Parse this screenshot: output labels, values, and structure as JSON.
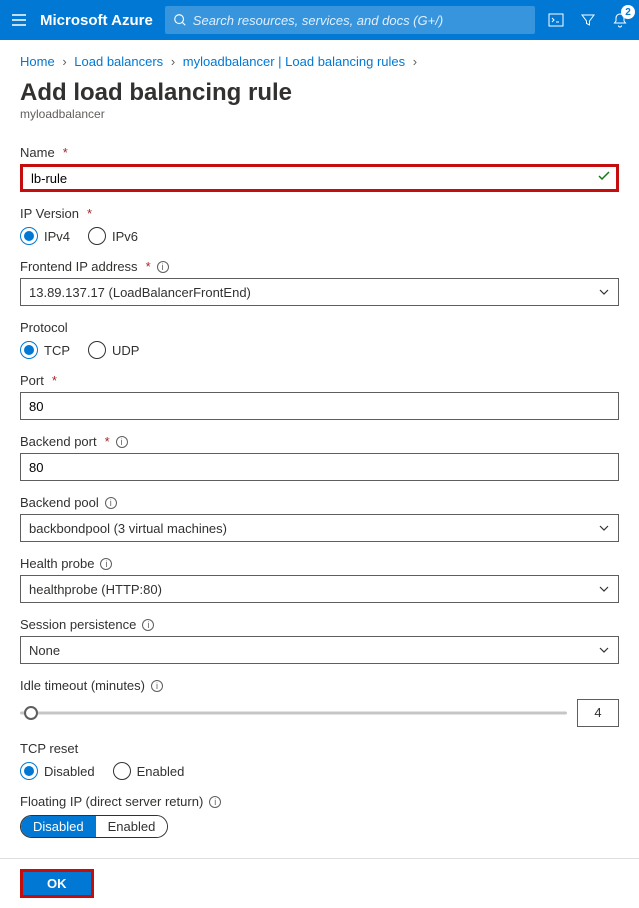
{
  "header": {
    "brand": "Microsoft Azure",
    "search_placeholder": "Search resources, services, and docs (G+/)",
    "notif_count": "2"
  },
  "breadcrumbs": [
    "Home",
    "Load balancers",
    "myloadbalancer | Load balancing rules"
  ],
  "page": {
    "title": "Add load balancing rule",
    "subtitle": "myloadbalancer"
  },
  "fields": {
    "name": {
      "label": "Name",
      "value": "lb-rule"
    },
    "ipversion": {
      "label": "IP Version",
      "options": [
        "IPv4",
        "IPv6"
      ],
      "selected": "IPv4"
    },
    "frontend": {
      "label": "Frontend IP address",
      "value": "13.89.137.17 (LoadBalancerFrontEnd)"
    },
    "protocol": {
      "label": "Protocol",
      "options": [
        "TCP",
        "UDP"
      ],
      "selected": "TCP"
    },
    "port": {
      "label": "Port",
      "value": "80"
    },
    "backendport": {
      "label": "Backend port",
      "value": "80"
    },
    "backendpool": {
      "label": "Backend pool",
      "value": "backbondpool (3 virtual machines)"
    },
    "healthprobe": {
      "label": "Health probe",
      "value": "healthprobe (HTTP:80)"
    },
    "session": {
      "label": "Session persistence",
      "value": "None"
    },
    "idle": {
      "label": "Idle timeout (minutes)",
      "value": "4"
    },
    "tcpreset": {
      "label": "TCP reset",
      "options": [
        "Disabled",
        "Enabled"
      ],
      "selected": "Disabled"
    },
    "floating": {
      "label": "Floating IP (direct server return)",
      "options": [
        "Disabled",
        "Enabled"
      ],
      "selected": "Disabled"
    }
  },
  "footer": {
    "ok": "OK"
  }
}
